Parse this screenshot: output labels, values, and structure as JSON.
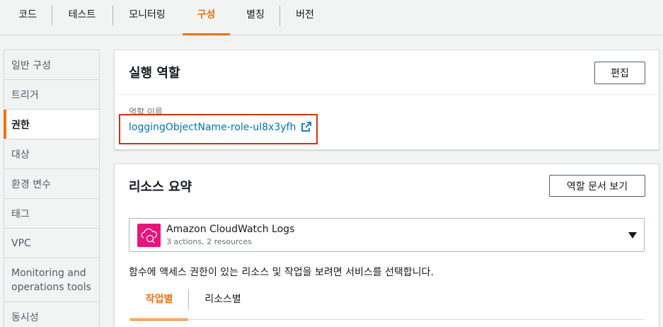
{
  "tabs": [
    {
      "label": "코드"
    },
    {
      "label": "테스트"
    },
    {
      "label": "모니터링"
    },
    {
      "label": "구성"
    },
    {
      "label": "별칭"
    },
    {
      "label": "버전"
    }
  ],
  "active_tab": "구성",
  "sidebar": {
    "items": [
      {
        "label": "일반 구성"
      },
      {
        "label": "트리거"
      },
      {
        "label": "권한"
      },
      {
        "label": "대상"
      },
      {
        "label": "환경 변수"
      },
      {
        "label": "태그"
      },
      {
        "label": "VPC"
      },
      {
        "label": "Monitoring and operations tools"
      },
      {
        "label": "동시성"
      }
    ],
    "active": "권한"
  },
  "execution_role": {
    "title": "실행 역할",
    "edit_label": "편집",
    "role_name_label": "역할 이름",
    "role_name": "loggingObjectName-role-ul8x3yfh"
  },
  "resource_summary": {
    "title": "리소스 요약",
    "view_doc_label": "역할 문서 보기",
    "service": {
      "name": "Amazon CloudWatch Logs",
      "desc": "3 actions, 2 resources",
      "icon": "cloudwatch-logs-icon"
    },
    "help_text": "함수에 액세스 권한이 있는 리소스 및 작업을 보려면 서비스를 선택합니다.",
    "subtabs": [
      {
        "label": "작업별"
      },
      {
        "label": "리소스별"
      }
    ],
    "active_subtab": "작업별"
  },
  "colors": {
    "accent": "#ec7211",
    "link": "#0073bb",
    "highlight": "#d13212",
    "service_icon_bg": "#e7157b"
  }
}
